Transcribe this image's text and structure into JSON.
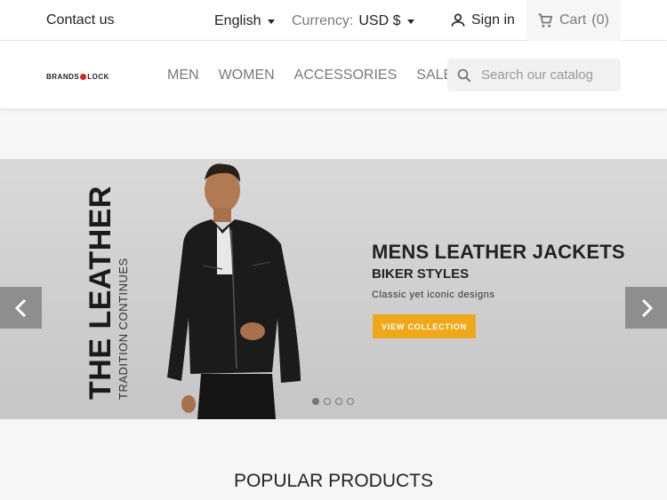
{
  "topbar": {
    "contact": "Contact us",
    "language": "English",
    "currency_label": "Currency:",
    "currency_value": "USD $",
    "signin": "Sign in",
    "cart": "Cart",
    "cart_count": "(0)"
  },
  "header": {
    "logo_left": "BRANDS",
    "logo_right": "LOCK",
    "nav": [
      "MEN",
      "WOMEN",
      "ACCESSORIES",
      "SALE"
    ],
    "search_placeholder": "Search our catalog"
  },
  "slider": {
    "vertical_title": "THE LEATHER",
    "vertical_subtitle": "TRADITION CONTINUES",
    "title": "MENS LEATHER JACKETS",
    "subtitle": "BIKER STYLES",
    "description": "Classic yet iconic designs",
    "cta": "VIEW COLLECTION",
    "slide_count": 4,
    "active_slide": 1
  },
  "sections": {
    "popular_title": "POPULAR PRODUCTS"
  },
  "colors": {
    "accent": "#f0a81b",
    "brand_red": "#d9241b"
  }
}
